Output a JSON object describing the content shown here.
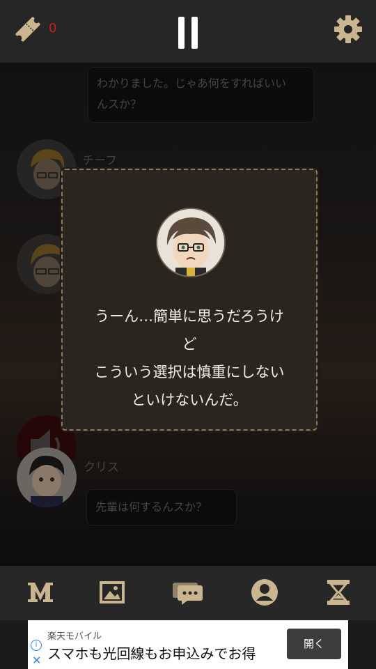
{
  "top_bar": {
    "ticket_count": "0",
    "ticket_color": "#d11c1c"
  },
  "chat": {
    "messages": [
      {
        "speaker": "",
        "text_lines": [
          "わかりました。じゃあ何をすればいい",
          "んスか？"
        ]
      },
      {
        "speaker": "チーフ",
        "text_lines": []
      },
      {
        "speaker": "クリス",
        "text_lines": [
          "先輩は何するんスか？"
        ]
      }
    ]
  },
  "modal": {
    "lines": [
      "うーん…簡単に思うだろうけ",
      "ど",
      "こういう選択は慎重にしない",
      "といけないんだ。"
    ]
  },
  "bottom_nav": {
    "items": [
      "menu-m-icon",
      "gallery-icon",
      "chat-icon",
      "profile-icon",
      "hourglass-icon"
    ]
  },
  "ad": {
    "sponsor": "楽天モバイル",
    "headline": "スマホも光回線もお申込みでお得",
    "button": "開く"
  }
}
